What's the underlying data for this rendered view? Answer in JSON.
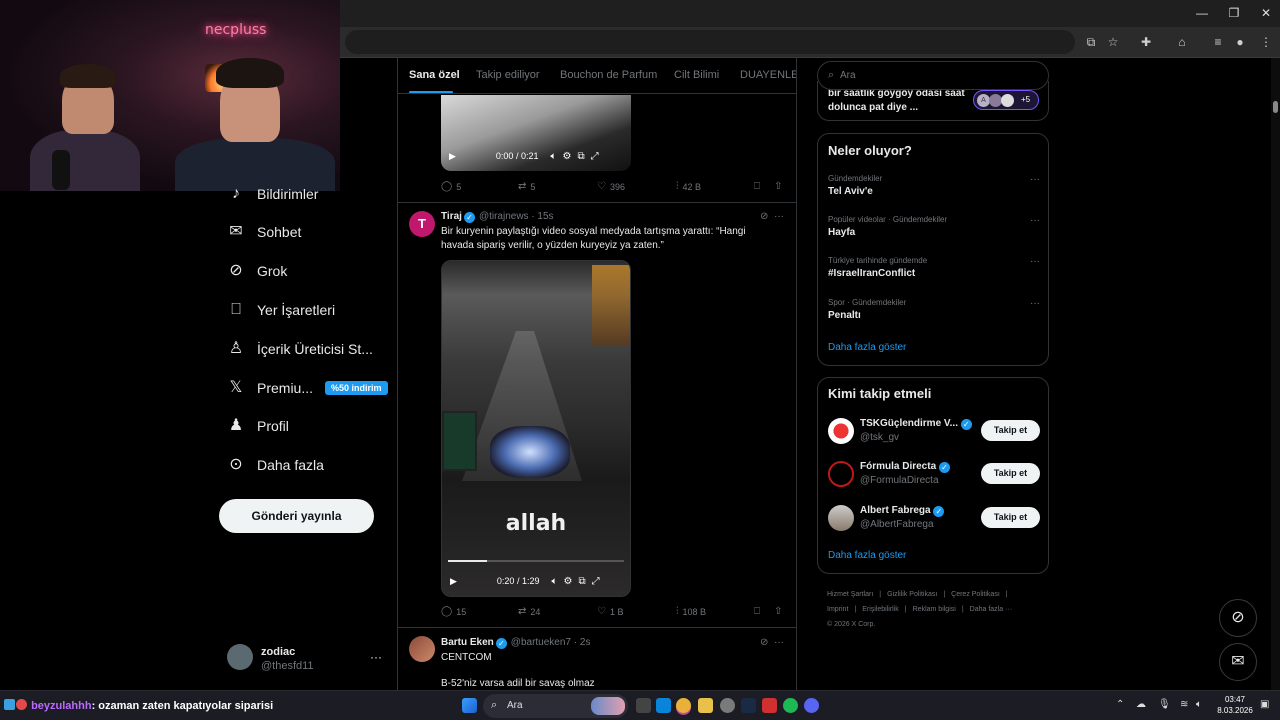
{
  "webcam": {
    "neon_text": "necpluss"
  },
  "nav": {
    "items": [
      {
        "label": "Bildirimler",
        "icon": "bell-icon"
      },
      {
        "label": "Sohbet",
        "icon": "mail-icon"
      },
      {
        "label": "Grok",
        "icon": "grok-icon"
      },
      {
        "label": "Yer İşaretleri",
        "icon": "bookmark-icon"
      },
      {
        "label": "İçerik Üreticisi St...",
        "icon": "creator-studio-icon"
      },
      {
        "label": "Premiu...",
        "icon": "x-logo-icon",
        "badge": "%50 indirim"
      },
      {
        "label": "Profil",
        "icon": "person-icon"
      },
      {
        "label": "Daha fazla",
        "icon": "more-circle-icon"
      }
    ],
    "post_button": "Gönderi yayınla",
    "account": {
      "name": "zodiac",
      "handle": "@thesfd11",
      "more": "···"
    }
  },
  "timeline": {
    "tabs": [
      "Sana özel",
      "Takip ediliyor",
      "Bouchon de Parfum",
      "Cilt Bilimi",
      "DUAYENLER"
    ],
    "tweet0": {
      "video_time": "0:00 / 0:21",
      "replies": "5",
      "reposts": "5",
      "likes": "396",
      "views": "42 B"
    },
    "tweet1": {
      "name": "Tiraj",
      "handle": "@tirajnews",
      "time": "· 15s",
      "avatar_letter": "T",
      "text": "Bir kuryenin paylaştığı video sosyal medyada tartışma yarattı: “Hangi havada sipariş verilir, o yüzden kuryeyiz ya zaten.”",
      "video_caption": "allah",
      "video_time": "0:20 / 1:29",
      "video_progress": 0.22,
      "replies": "15",
      "reposts": "24",
      "likes": "1 B",
      "views": "108 B"
    },
    "tweet2": {
      "name": "Bartu Eken",
      "handle": "@bartueken7",
      "time": "· 2s",
      "line1": "CENTCOM",
      "line2": "B-52'niz varsa adil bir savaş olmaz"
    }
  },
  "right": {
    "search_placeholder": "Ara",
    "space": {
      "title": "bir saatlik göygöy odası saat dolunca pat diye ...",
      "initial": "A",
      "count": "+5"
    },
    "trends": {
      "title": "Neler oluyor?",
      "items": [
        {
          "context": "Gündemdekiler",
          "name": "Tel Aviv'e"
        },
        {
          "context": "Popüler videolar · Gündemdekiler",
          "name": "Hayfa"
        },
        {
          "context": "Türkiye tarihinde gündemde",
          "name": "#IsraelIranConflict"
        },
        {
          "context": "Spor · Gündemdekiler",
          "name": "Penaltı"
        }
      ],
      "show_more": "Daha fazla göster"
    },
    "who_to_follow": {
      "title": "Kimi takip etmeli",
      "items": [
        {
          "name": "TSKGüçlendirme V...",
          "handle": "@tsk_gv",
          "button": "Takip et"
        },
        {
          "name": "Fórmula Directa",
          "handle": "@FormulaDirecta",
          "button": "Takip et"
        },
        {
          "name": "Albert Fabrega",
          "handle": "@AlbertFabrega",
          "button": "Takip et"
        }
      ],
      "show_more": "Daha fazla göster"
    },
    "footer": {
      "links": [
        "Hizmet Şartları",
        "|",
        "Gizlilik Politikası",
        "|",
        "Çerez Politikası",
        "|",
        "Imprint",
        "|",
        "Erişilebilirlik",
        "|",
        "Reklam bilgisi",
        "|",
        "Daha fazla ···"
      ],
      "copyright": "© 2026 X Corp."
    }
  },
  "taskbar": {
    "chat_user": "beyzulahhh",
    "chat_message": ": ozaman zaten kapatıyolar siparisi",
    "search_placeholder": "Ara",
    "time": "03:47",
    "date": "8.03.2026"
  },
  "colors": {
    "accent": "#1d9bf0",
    "background": "#000000",
    "text": "#e7e9ea",
    "muted": "#71767b"
  }
}
